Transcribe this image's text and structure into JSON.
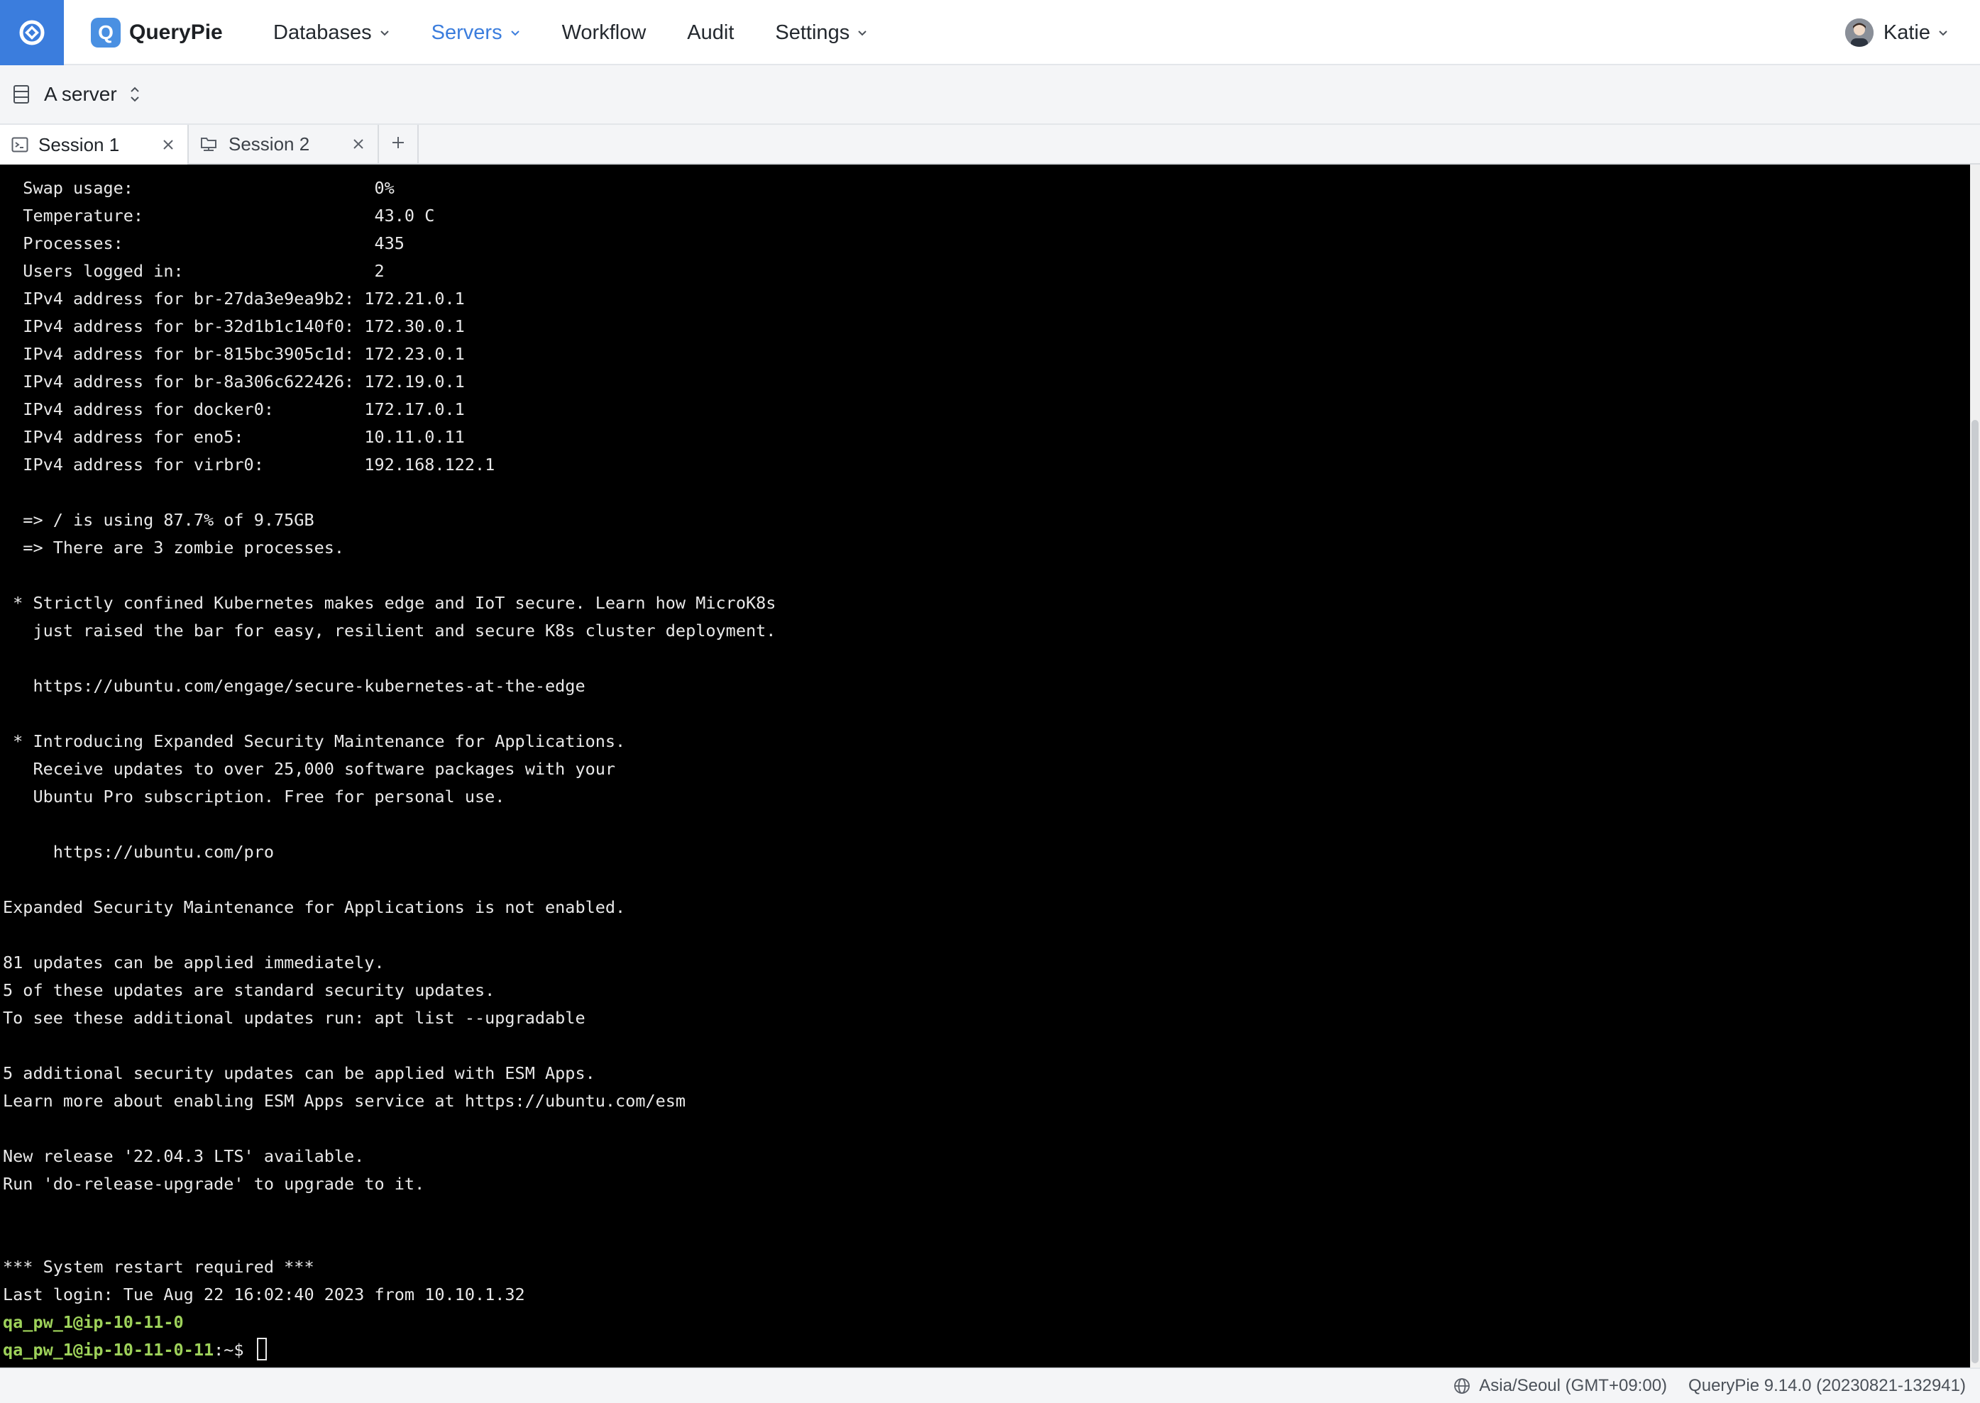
{
  "app": {
    "name": "QueryPie"
  },
  "nav": {
    "items": [
      {
        "label": "Databases",
        "has_menu": true,
        "active": false
      },
      {
        "label": "Servers",
        "has_menu": true,
        "active": true
      },
      {
        "label": "Workflow",
        "has_menu": false,
        "active": false
      },
      {
        "label": "Audit",
        "has_menu": false,
        "active": false
      },
      {
        "label": "Settings",
        "has_menu": true,
        "active": false
      }
    ]
  },
  "user": {
    "name": "Katie"
  },
  "server": {
    "name": "A server"
  },
  "tabs": [
    {
      "label": "Session 1",
      "active": true,
      "icon": "terminal-icon"
    },
    {
      "label": "Session 2",
      "active": false,
      "icon": "sftp-icon"
    }
  ],
  "terminal": {
    "lines": [
      "  Swap usage:                        0%",
      "  Temperature:                       43.0 C",
      "  Processes:                         435",
      "  Users logged in:                   2",
      "  IPv4 address for br-27da3e9ea9b2: 172.21.0.1",
      "  IPv4 address for br-32d1b1c140f0: 172.30.0.1",
      "  IPv4 address for br-815bc3905c1d: 172.23.0.1",
      "  IPv4 address for br-8a306c622426: 172.19.0.1",
      "  IPv4 address for docker0:         172.17.0.1",
      "  IPv4 address for eno5:            10.11.0.11",
      "  IPv4 address for virbr0:          192.168.122.1",
      "",
      "  => / is using 87.7% of 9.75GB",
      "  => There are 3 zombie processes.",
      "",
      " * Strictly confined Kubernetes makes edge and IoT secure. Learn how MicroK8s",
      "   just raised the bar for easy, resilient and secure K8s cluster deployment.",
      "",
      "   https://ubuntu.com/engage/secure-kubernetes-at-the-edge",
      "",
      " * Introducing Expanded Security Maintenance for Applications.",
      "   Receive updates to over 25,000 software packages with your",
      "   Ubuntu Pro subscription. Free for personal use.",
      "",
      "     https://ubuntu.com/pro",
      "",
      "Expanded Security Maintenance for Applications is not enabled.",
      "",
      "81 updates can be applied immediately.",
      "5 of these updates are standard security updates.",
      "To see these additional updates run: apt list --upgradable",
      "",
      "5 additional security updates can be applied with ESM Apps.",
      "Learn more about enabling ESM Apps service at https://ubuntu.com/esm",
      "",
      "New release '22.04.3 LTS' available.",
      "Run 'do-release-upgrade' to upgrade to it.",
      "",
      "",
      "*** System restart required ***",
      "Last login: Tue Aug 22 16:02:40 2023 from 10.10.1.32"
    ],
    "host_line": "qa_pw_1@ip-10-11-0",
    "prompt": "qa_pw_1@ip-10-11-0-11",
    "prompt_suffix": ":~$ "
  },
  "status": {
    "timezone": "Asia/Seoul (GMT+09:00)",
    "version": "QueryPie 9.14.0 (20230821-132941)"
  },
  "colors": {
    "brand": "#3b7ddd",
    "prompt_green": "#9ed25a",
    "terminal_bg": "#000000"
  }
}
